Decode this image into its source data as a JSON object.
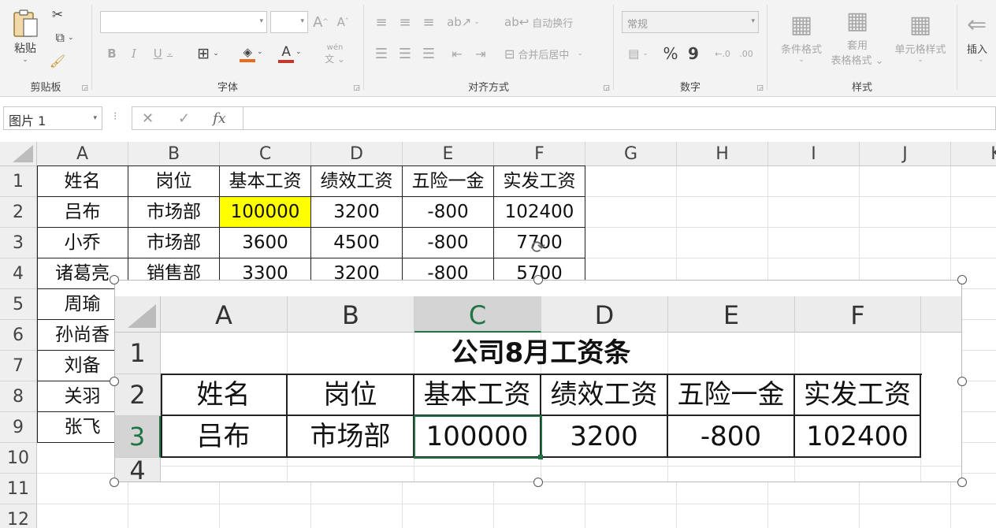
{
  "ribbon": {
    "clipboard": {
      "paste": "粘贴",
      "group": "剪贴板"
    },
    "font": {
      "bold": "B",
      "italic": "I",
      "underline": "U",
      "grow": "A",
      "shrink": "A",
      "phonetic": "wén",
      "group": "字体"
    },
    "alignment": {
      "wrap": "自动换行",
      "merge": "合并后居中",
      "group": "对齐方式"
    },
    "number": {
      "format": "常规",
      "percent": "%",
      "comma": "9",
      "group": "数字"
    },
    "styles": {
      "conditional": "条件格式",
      "table_format_1": "套用",
      "table_format_2": "表格格式",
      "cell_styles": "单元格样式",
      "group": "样式"
    },
    "cells": {
      "insert": "插入"
    }
  },
  "formula_bar": {
    "name_box": "图片 1",
    "fx": "fx"
  },
  "sheet": {
    "columns": [
      "A",
      "B",
      "C",
      "D",
      "E",
      "F",
      "G",
      "H",
      "I",
      "J",
      "K"
    ],
    "rows": [
      "1",
      "2",
      "3",
      "4",
      "5",
      "6",
      "7",
      "8",
      "9",
      "10",
      "11",
      "12"
    ],
    "header": [
      "姓名",
      "岗位",
      "基本工资",
      "绩效工资",
      "五险一金",
      "实发工资"
    ],
    "data": [
      [
        "吕布",
        "市场部",
        "100000",
        "3200",
        "-800",
        "102400"
      ],
      [
        "小乔",
        "市场部",
        "3600",
        "4500",
        "-800",
        "7700"
      ],
      [
        "诸葛亮",
        "销售部",
        "3300",
        "3200",
        "-800",
        "5700"
      ]
    ],
    "names_more": [
      "周瑜",
      "孙尚香",
      "刘备",
      "关羽",
      "张飞"
    ],
    "highlight_color": "#ffff00"
  },
  "picture": {
    "columns": [
      "A",
      "B",
      "C",
      "D",
      "E",
      "F"
    ],
    "rows": [
      "1",
      "2",
      "3",
      "4"
    ],
    "title": "公司8月工资条",
    "header": [
      "姓名",
      "岗位",
      "基本工资",
      "绩效工资",
      "五险一金",
      "实发工资"
    ],
    "row": [
      "吕布",
      "市场部",
      "100000",
      "3200",
      "-800",
      "102400"
    ],
    "accent": "#217346"
  }
}
